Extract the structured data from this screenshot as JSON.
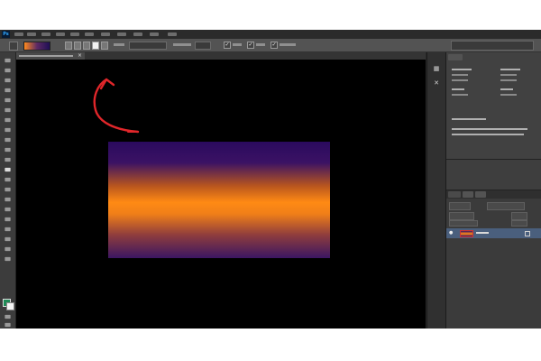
{
  "app": {
    "logo_text": "Ps"
  },
  "menu": {
    "items": [
      "",
      "",
      "",
      "",
      "",
      "",
      "",
      "",
      "",
      "",
      ""
    ]
  },
  "options_bar": {
    "mode_value": "",
    "opacity_value": "",
    "checkbox_checked": "✓"
  },
  "document_tab": {
    "title": "",
    "close_glyph": "×"
  },
  "right_panel": {
    "info_text": ""
  },
  "layers": {
    "rows": [
      {
        "name": "",
        "visible_glyph": "●"
      }
    ]
  },
  "colors": {
    "foreground": "#1d8a55",
    "background": "#f5f5f5",
    "gradient_top": "#2a0a5e",
    "gradient_mid": "#ff8a14",
    "annotation_arrow": "#e0262a"
  }
}
